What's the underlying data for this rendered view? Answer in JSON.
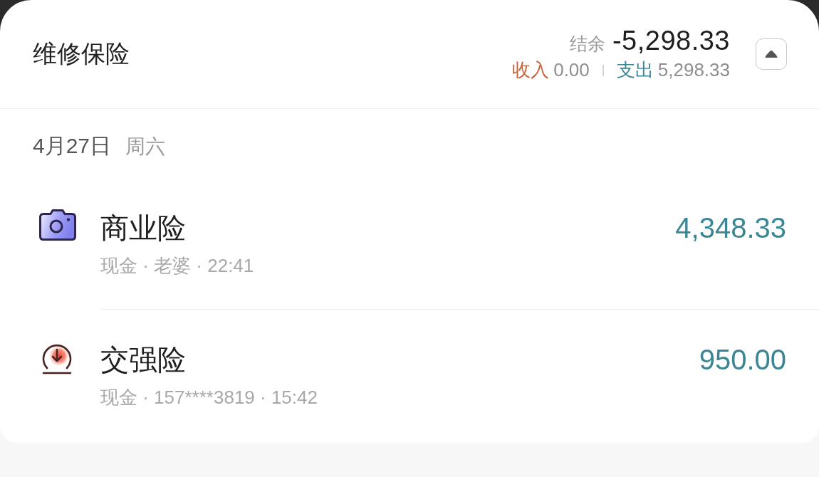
{
  "header": {
    "title": "维修保险",
    "balance_label": "结余",
    "balance": "-5,298.33",
    "income_label": "收入",
    "income": "0.00",
    "expense_label": "支出",
    "expense": "5,298.33"
  },
  "day": {
    "date": "4月27日",
    "weekday": "周六"
  },
  "entries": [
    {
      "kind": "camera",
      "title": "商业险",
      "details": "现金 · 老婆 · 22:41",
      "amount": "4,348.33"
    },
    {
      "kind": "download",
      "title": "交强险",
      "details": "现金 · 157****3819 · 15:42",
      "amount": "950.00"
    }
  ]
}
